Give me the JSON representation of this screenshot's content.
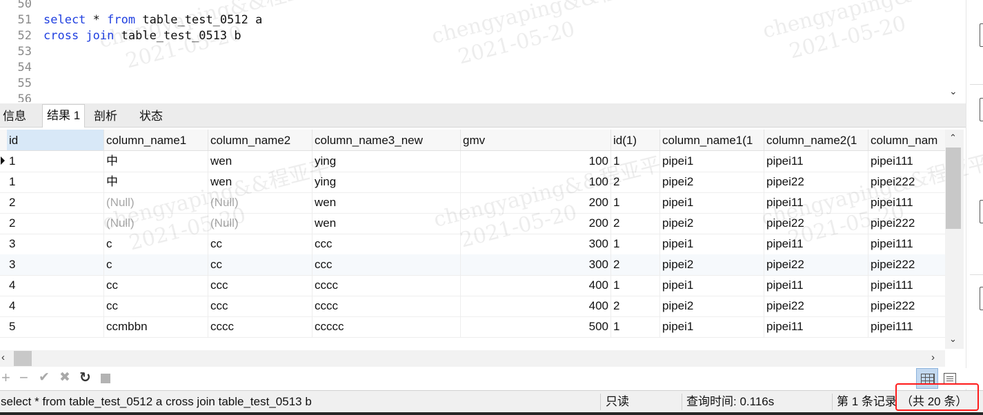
{
  "editor": {
    "lines": [
      {
        "num": "50",
        "tokens": []
      },
      {
        "num": "51",
        "tokens": [
          {
            "t": "select",
            "k": "kw"
          },
          {
            "t": " * ",
            "k": "plain"
          },
          {
            "t": "from",
            "k": "kw"
          },
          {
            "t": " table_test_0512 a",
            "k": "plain"
          }
        ]
      },
      {
        "num": "52",
        "tokens": [
          {
            "t": "cross",
            "k": "kw"
          },
          {
            "t": " ",
            "k": "plain"
          },
          {
            "t": "join",
            "k": "kw"
          },
          {
            "t": " table_test_0513 b",
            "k": "plain"
          }
        ]
      },
      {
        "num": "53",
        "tokens": []
      },
      {
        "num": "54",
        "tokens": []
      },
      {
        "num": "55",
        "tokens": []
      },
      {
        "num": "56",
        "tokens": []
      }
    ]
  },
  "tabs": [
    {
      "label": "信息",
      "active": false
    },
    {
      "label": "结果 1",
      "active": true
    },
    {
      "label": "剖析",
      "active": false
    },
    {
      "label": "状态",
      "active": false
    }
  ],
  "grid": {
    "columns": [
      "id",
      "column_name1",
      "column_name2",
      "column_name3_new",
      "gmv",
      "id(1)",
      "column_name1(1",
      "column_name2(1",
      "column_nam"
    ],
    "numeric_columns": [
      4
    ],
    "rows": [
      [
        "1",
        "中",
        "wen",
        "ying",
        "100",
        "1",
        "pipei1",
        "pipei11",
        "pipei111"
      ],
      [
        "1",
        "中",
        "wen",
        "ying",
        "100",
        "2",
        "pipei2",
        "pipei22",
        "pipei222"
      ],
      [
        "2",
        "(Null)",
        "(Null)",
        "wen",
        "200",
        "1",
        "pipei1",
        "pipei11",
        "pipei111"
      ],
      [
        "2",
        "(Null)",
        "(Null)",
        "wen",
        "200",
        "2",
        "pipei2",
        "pipei22",
        "pipei222"
      ],
      [
        "3",
        "c",
        "cc",
        "ccc",
        "300",
        "1",
        "pipei1",
        "pipei11",
        "pipei111"
      ],
      [
        "3",
        "c",
        "cc",
        "ccc",
        "300",
        "2",
        "pipei2",
        "pipei22",
        "pipei222"
      ],
      [
        "4",
        "cc",
        "ccc",
        "cccc",
        "400",
        "1",
        "pipei1",
        "pipei11",
        "pipei111"
      ],
      [
        "4",
        "cc",
        "ccc",
        "cccc",
        "400",
        "2",
        "pipei2",
        "pipei22",
        "pipei222"
      ],
      [
        "5",
        "ccmbbn",
        "cccc",
        "ccccc",
        "500",
        "1",
        "pipei1",
        "pipei11",
        "pipei111"
      ]
    ],
    "selected_row": 0
  },
  "toolbar": {
    "add": "+",
    "delete": "−",
    "apply": "✔",
    "discard": "✖",
    "refresh": "↻",
    "stop": ""
  },
  "status": {
    "sql": "select * from table_test_0512 a cross join table_test_0513 b",
    "readonly": "只读",
    "query_time": "查询时间: 0.116s",
    "record": "第 1 条记录",
    "total": "（共 20 条）"
  },
  "watermark": {
    "line1": "chengyaping&&程亚平",
    "line2": "2021-05-20"
  },
  "colors": {
    "keyword": "#1f3fe0",
    "null_text": "#a7a7a7",
    "highlight_box": "#ff1a1a",
    "selected_header": "#d8e8f7"
  }
}
